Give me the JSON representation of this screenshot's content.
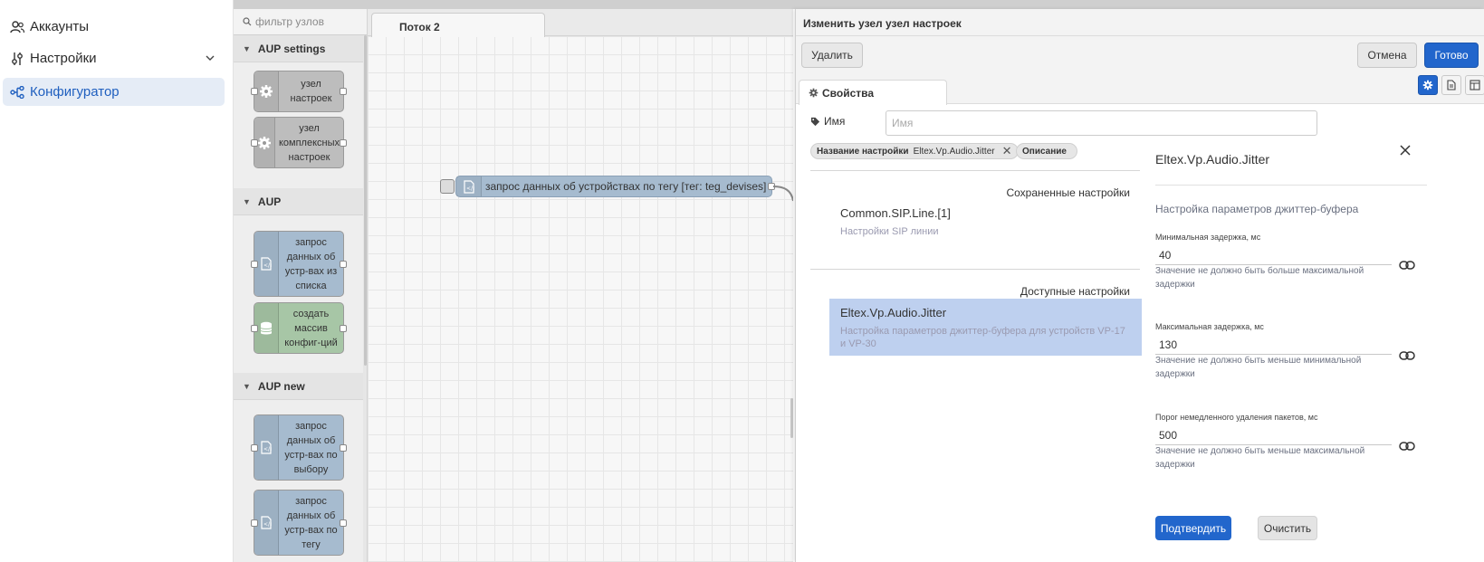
{
  "nav": {
    "items": [
      {
        "label": "Аккаунты"
      },
      {
        "label": "Настройки"
      },
      {
        "label": "Конфигуратор"
      }
    ]
  },
  "palette": {
    "filter_placeholder": "фильтр узлов",
    "categories": [
      {
        "name": "AUP settings",
        "nodes": [
          {
            "label": "узел настроек"
          },
          {
            "label": "узел комплексных настроек"
          }
        ]
      },
      {
        "name": "AUP",
        "nodes": [
          {
            "label": "запрос данных об устр-вах из списка"
          },
          {
            "label": "создать массив конфиг-ций"
          }
        ]
      },
      {
        "name": "AUP new",
        "nodes": [
          {
            "label": "запрос данных об устр-вах по выбору"
          },
          {
            "label": "запрос данных об устр-вах по тегу"
          }
        ]
      }
    ]
  },
  "workspace": {
    "tab_label": "Поток 2",
    "node_label": "запрос данных об устройствах по тегу [тег: teg_devises]"
  },
  "tray": {
    "title": "Изменить узел узел настроек",
    "delete_label": "Удалить",
    "cancel_label": "Отмена",
    "done_label": "Готово",
    "tab_label": "Свойства",
    "name_label": "Имя",
    "name_placeholder": "Имя",
    "chips": [
      {
        "key": "Название настройки",
        "value": "Eltex.Vp.Audio.Jitter"
      },
      {
        "key": "Описание",
        "value": ""
      }
    ],
    "saved_title": "Сохраненные настройки",
    "saved_items": [
      {
        "title": "Common.SIP.Line.[1]",
        "desc": "Настройки SIP линии"
      }
    ],
    "available_title": "Доступные настройки",
    "available_items": [
      {
        "title": "Eltex.Vp.Audio.Jitter",
        "desc": "Настройка параметров джиттер-буфера для устройств VP-17 и VP-30"
      }
    ]
  },
  "form": {
    "title": "Eltex.Vp.Audio.Jitter",
    "description": "Настройка параметров джиттер-буфера",
    "fields": [
      {
        "label": "Минимальная задержка, мс",
        "value": "40",
        "hint": "Значение не должно быть больше максимальной задержки"
      },
      {
        "label": "Максимальная задержка, мс",
        "value": "130",
        "hint": "Значение не должно быть меньше минимальной задержки"
      },
      {
        "label": "Порог немедленного удаления пакетов, мс",
        "value": "500",
        "hint": "Значение не должно быть меньше максимальной задержки"
      }
    ],
    "confirm_label": "Подтвердить",
    "clear_label": "Очистить"
  },
  "colors": {
    "accent": "#2266cc",
    "selected": "#bed0ef",
    "node_blue": "#a6bbcf",
    "node_green": "#a7c6a6",
    "node_gray": "#bdbdbd"
  }
}
